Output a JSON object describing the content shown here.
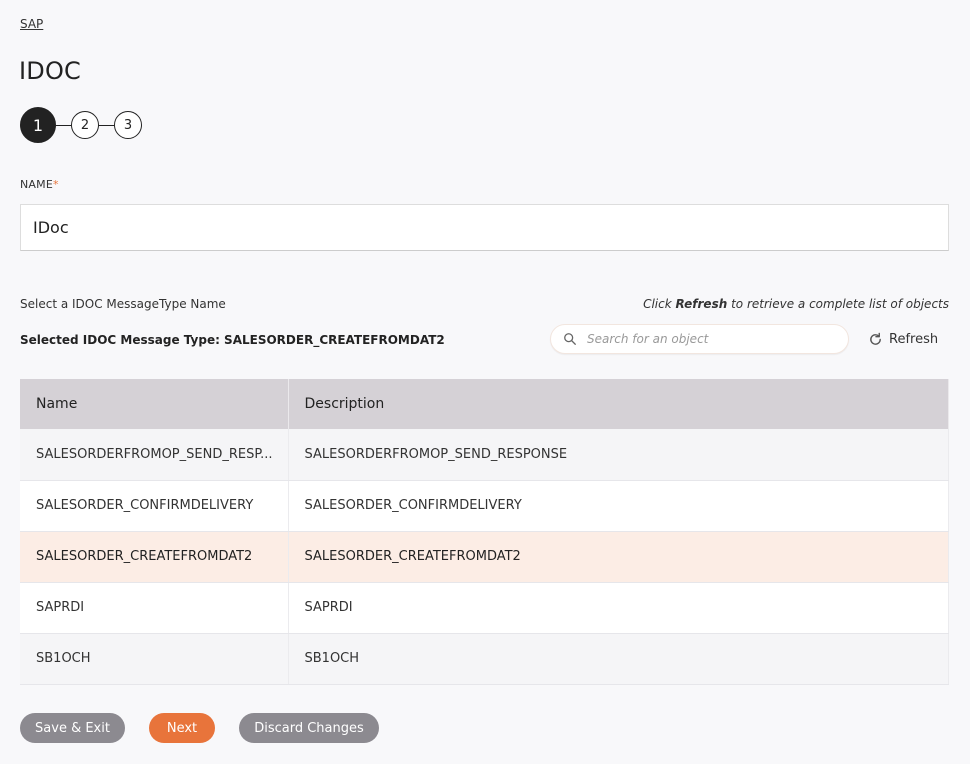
{
  "breadcrumb": "SAP",
  "title": "IDOC",
  "stepper": {
    "steps": [
      "1",
      "2",
      "3"
    ],
    "active": 1
  },
  "name_field": {
    "label": "NAME",
    "required_mark": "*",
    "value": "IDoc"
  },
  "select_label": "Select a IDOC MessageType Name",
  "refresh_hint": {
    "prefix": "Click ",
    "bold": "Refresh",
    "suffix": " to retrieve a complete list of objects"
  },
  "selected_type": "Selected IDOC Message Type: SALESORDER_CREATEFROMDAT2",
  "search": {
    "placeholder": "Search for an object",
    "icon": "search-icon"
  },
  "refresh_button": {
    "label": "Refresh",
    "icon": "refresh-icon"
  },
  "table": {
    "columns": [
      "Name",
      "Description"
    ],
    "rows": [
      {
        "name": "SALESORDERFROMOP_SEND_RESP...",
        "description": "SALESORDERFROMOP_SEND_RESPONSE",
        "selected": false
      },
      {
        "name": "SALESORDER_CONFIRMDELIVERY",
        "description": "SALESORDER_CONFIRMDELIVERY",
        "selected": false
      },
      {
        "name": "SALESORDER_CREATEFROMDAT2",
        "description": "SALESORDER_CREATEFROMDAT2",
        "selected": true
      },
      {
        "name": "SAPRDI",
        "description": "SAPRDI",
        "selected": false
      },
      {
        "name": "SB1OCH",
        "description": "SB1OCH",
        "selected": false
      }
    ]
  },
  "buttons": {
    "save_exit": "Save & Exit",
    "next": "Next",
    "discard": "Discard Changes"
  },
  "colors": {
    "accent": "#e8743b",
    "selected_row": "#fcede5",
    "header_bg": "#d5d1d6",
    "secondary_button": "#8c8a90"
  }
}
